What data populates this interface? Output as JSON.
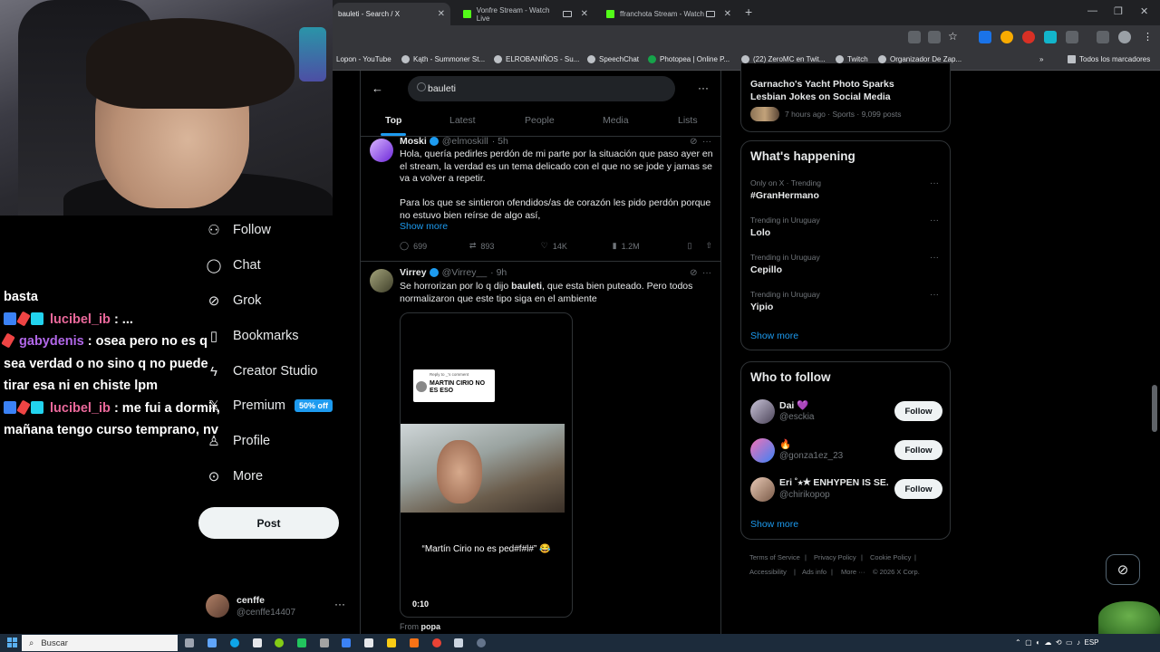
{
  "browser": {
    "tabs": [
      {
        "title": "bauleti - Search / X",
        "active": true
      },
      {
        "title": "Vonfre Stream - Watch Live",
        "active": false
      },
      {
        "title": "ffranchota Stream - Watch Live",
        "active": false
      }
    ],
    "bookmarks": [
      "Lopon - YouTube",
      "Kąth - Summoner St...",
      "ELROBANIÑOS - Su...",
      "SpeechChat",
      "Photopea | Online P...",
      "(22) ZeroMC en Twit...",
      "Twitch",
      "Organizador De Zap..."
    ],
    "bookmarks_folder": "Todos los marcadores"
  },
  "stream_chat": {
    "lines": [
      {
        "user": "",
        "text": "basta"
      },
      {
        "user": "lucibel_ib",
        "text": " : ..."
      },
      {
        "user": "gabydenis",
        "text": " : osea pero no es q sea verdad o no sino q no puede tirar esa ni en chiste lpm"
      },
      {
        "user": "lucibel_ib",
        "text": " : me fui a dormir, mañana tengo curso temprano, nv"
      }
    ]
  },
  "nav": {
    "items": [
      {
        "label": "Follow",
        "icon": "person-plus-icon"
      },
      {
        "label": "Chat",
        "icon": "chat-bubble-icon"
      },
      {
        "label": "Grok",
        "icon": "grok-icon"
      },
      {
        "label": "Bookmarks",
        "icon": "bookmark-icon"
      },
      {
        "label": "Creator Studio",
        "icon": "lightning-icon"
      },
      {
        "label": "Premium",
        "icon": "x-logo-icon"
      },
      {
        "label": "Profile",
        "icon": "person-icon"
      },
      {
        "label": "More",
        "icon": "more-circle-icon"
      }
    ],
    "premium_badge": "50% off",
    "post_button": "Post",
    "account": {
      "name": "cenffe",
      "handle": "@cenffe14407"
    }
  },
  "search": {
    "query": "bauleti",
    "tabs": [
      "Top",
      "Latest",
      "People",
      "Media",
      "Lists"
    ],
    "active_tab": "Top"
  },
  "posts": [
    {
      "name": "Moski",
      "handle": "@elmoskill",
      "time": "· 5h",
      "text1": "Hola, quería pedirles perdón de mi parte por la situación que paso ayer en el stream, la verdad es un tema delicado con el que no se jode y jamas se va a volver a repetir.",
      "text2": "Para los que se sintieron ofendidos/as de corazón les pido perdón porque no estuvo bien reírse de algo así,",
      "show_more": "Show more",
      "replies": "699",
      "reposts": "893",
      "likes": "14K",
      "views": "1.2M"
    },
    {
      "name": "Virrey",
      "handle": "@Virrey__",
      "time": "· 9h",
      "text_before": "Se horrorizan por lo q dijo ",
      "text_bold": "bauleti",
      "text_after": ", que esta bien puteado. Pero todos normalizaron que este tipo siga en el ambiente",
      "video": {
        "reply_to": "Reply to _'s comment",
        "reply_text": "MARTIN CIRIO NO ES ESO",
        "caption": "“Martín Cirio no es ped#f#l#” 😂",
        "duration": "0:10"
      },
      "from_label": "From",
      "from_user": "popa"
    }
  ],
  "right": {
    "top_news": {
      "title": "Garnacho's Yacht Photo Sparks Lesbian Jokes on Social Media",
      "meta": "7 hours ago · Sports · 9,099 posts"
    },
    "happening": {
      "title": "What's happening",
      "trends": [
        {
          "context": "Only on X · Trending",
          "name": "#GranHermano"
        },
        {
          "context": "Trending in Uruguay",
          "name": "Lolo"
        },
        {
          "context": "Trending in Uruguay",
          "name": "Cepillo"
        },
        {
          "context": "Trending in Uruguay",
          "name": "Yipio"
        }
      ],
      "show_more": "Show more"
    },
    "who_to_follow": {
      "title": "Who to follow",
      "users": [
        {
          "name": "Dai 💜",
          "handle": "@esckia",
          "button": "Follow"
        },
        {
          "name": "🔥",
          "handle": "@gonza1ez_23",
          "button": "Follow"
        },
        {
          "name": "Eri ˚⭑★ ENHYPEN IS SE...",
          "handle": "@chirikopop",
          "button": "Follow"
        }
      ],
      "show_more": "Show more"
    },
    "footer": [
      "Terms of Service",
      "|",
      "Privacy Policy",
      "|",
      "Cookie Policy",
      "|",
      "Accessibility",
      "|",
      "Ads info",
      "|",
      "More ···",
      "© 2026 X Corp."
    ]
  },
  "taskbar": {
    "search": "Buscar",
    "lang": "ESP"
  },
  "colors": {
    "accent": "#1d9bf0",
    "bg": "#000000",
    "border": "#2f3336",
    "muted": "#71767b"
  }
}
